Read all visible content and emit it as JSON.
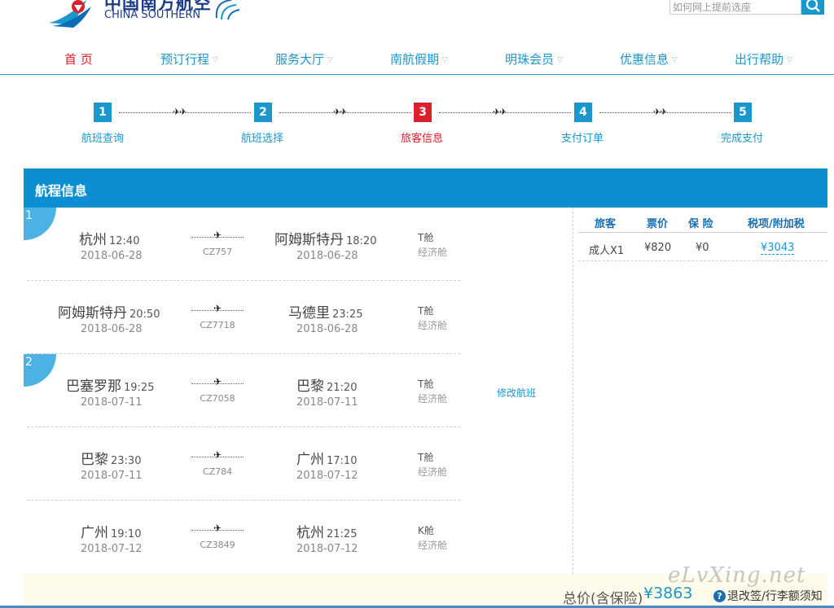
{
  "header": {
    "logo_cn": "中国南方航空",
    "logo_en": "CHINA SOUTHERN",
    "search_placeholder": "如何网上提前选座"
  },
  "nav": [
    {
      "label": "首 页",
      "active": true
    },
    {
      "label": "预订行程",
      "active": false
    },
    {
      "label": "服务大厅",
      "active": false
    },
    {
      "label": "南航假期",
      "active": false
    },
    {
      "label": "明珠会员",
      "active": false
    },
    {
      "label": "优惠信息",
      "active": false
    },
    {
      "label": "出行帮助",
      "active": false
    }
  ],
  "steps": [
    {
      "num": "1",
      "label": "航班查询",
      "current": false
    },
    {
      "num": "2",
      "label": "航班选择",
      "current": false
    },
    {
      "num": "3",
      "label": "旅客信息",
      "current": true
    },
    {
      "num": "4",
      "label": "支付订单",
      "current": false
    },
    {
      "num": "5",
      "label": "完成支付",
      "current": false
    }
  ],
  "section_title": "航程信息",
  "segments": [
    {
      "num": "1"
    },
    {
      "num": "2"
    }
  ],
  "flights": [
    {
      "from": "杭州",
      "dep_time": "12:40",
      "dep_date": "2018-06-28",
      "flight_no": "CZ757",
      "to": "阿姆斯特丹",
      "arr_time": "18:20",
      "arr_date": "2018-06-28",
      "cabin": "T舱",
      "cabin_type": "经济舱"
    },
    {
      "from": "阿姆斯特丹",
      "dep_time": "20:50",
      "dep_date": "2018-06-28",
      "flight_no": "CZ7718",
      "to": "马德里",
      "arr_time": "23:25",
      "arr_date": "2018-06-28",
      "cabin": "T舱",
      "cabin_type": "经济舱"
    },
    {
      "from": "巴塞罗那",
      "dep_time": "19:25",
      "dep_date": "2018-07-11",
      "flight_no": "CZ7058",
      "to": "巴黎",
      "arr_time": "21:20",
      "arr_date": "2018-07-11",
      "cabin": "T舱",
      "cabin_type": "经济舱"
    },
    {
      "from": "巴黎",
      "dep_time": "23:30",
      "dep_date": "2018-07-11",
      "flight_no": "CZ784",
      "to": "广州",
      "arr_time": "17:10",
      "arr_date": "2018-07-12",
      "cabin": "T舱",
      "cabin_type": "经济舱"
    },
    {
      "from": "广州",
      "dep_time": "19:10",
      "dep_date": "2018-07-12",
      "flight_no": "CZ3849",
      "to": "杭州",
      "arr_time": "21:25",
      "arr_date": "2018-07-12",
      "cabin": "K舱",
      "cabin_type": "经济舱"
    }
  ],
  "modify_flight": "修改航班",
  "price_table": {
    "headers": [
      "旅客",
      "票价",
      "保 险",
      "税项/附加税"
    ],
    "row": {
      "passenger": "成人X1",
      "fare": "¥820",
      "insurance": "¥0",
      "tax": "¥3043"
    }
  },
  "total": {
    "label": "总价(含保险)",
    "price": "¥3863"
  },
  "help_link": "退改签/行李额须知",
  "watermark": "eLvXing.net",
  "colors": {
    "accent": "#0b8fd2",
    "current_step": "#d8212a"
  }
}
